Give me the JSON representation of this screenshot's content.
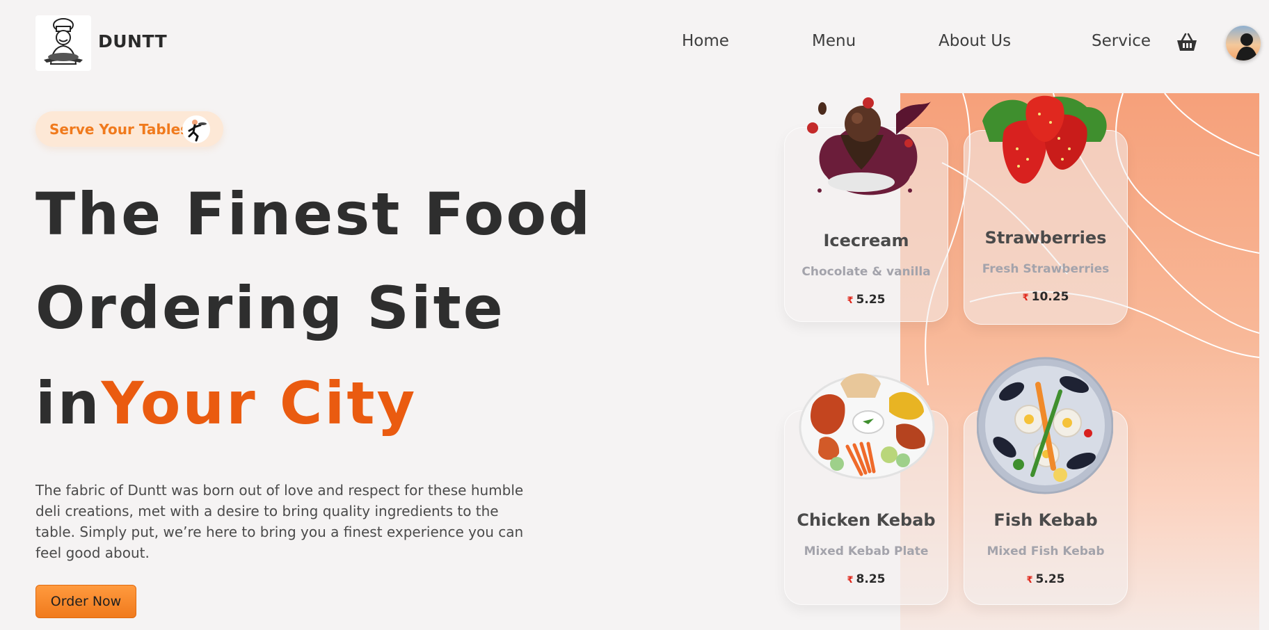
{
  "header": {
    "brand": "DUNTT",
    "nav": [
      "Home",
      "Menu",
      "About Us",
      "Service"
    ]
  },
  "hero": {
    "badge": "Serve Your Tables",
    "headline_line1": "The Finest Food",
    "headline_line2": "Ordering Site",
    "headline_line3_plain": "in",
    "headline_line3_accent": "Your City",
    "description": "The fabric of Duntt was born out of love and respect for these humble deli creations, met with a desire to bring quality ingredients to the table. Simply put, we’re here to bring you a finest experience you can feel good about.",
    "cta": "Order Now"
  },
  "menu": [
    {
      "title": "Icecream",
      "subtitle": "Chocolate & vanilla",
      "currency": "₹",
      "price": "5.25"
    },
    {
      "title": "Strawberries",
      "subtitle": "Fresh Strawberries",
      "currency": "₹",
      "price": "10.25"
    },
    {
      "title": "Chicken Kebab",
      "subtitle": "Mixed Kebab Plate",
      "currency": "₹",
      "price": "8.25"
    },
    {
      "title": "Fish Kebab",
      "subtitle": "Mixed Fish Kebab",
      "currency": "₹",
      "price": "5.25"
    }
  ],
  "colors": {
    "accent": "#ea5b10",
    "button": "#f07a1d",
    "badge_bg": "#fde8d6",
    "panel_top": "#f6a07a",
    "background": "#f5f3f3"
  },
  "icons": [
    "chef-logo-icon",
    "basket-icon",
    "user-avatar-icon",
    "waiter-icon"
  ]
}
